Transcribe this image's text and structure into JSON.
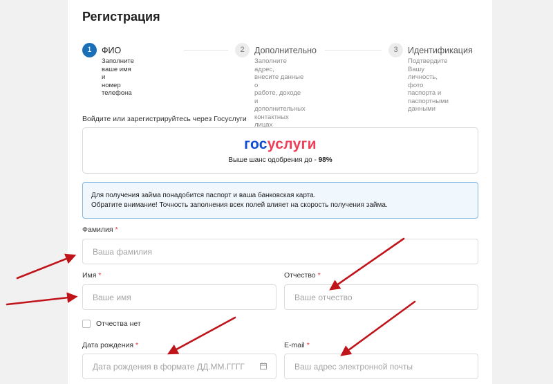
{
  "page": {
    "title": "Регистрация"
  },
  "steps": [
    {
      "number": "1",
      "title": "ФИО",
      "desc_lines": [
        "Заполните ваше имя и",
        "номер телефона"
      ]
    },
    {
      "number": "2",
      "title": "Дополнительно",
      "desc_lines": [
        "Заполните адрес,",
        "внесите данные о",
        "работе, доходе и",
        "дополнительных",
        "контактных лицах"
      ]
    },
    {
      "number": "3",
      "title": "Идентификация",
      "desc_lines": [
        "Подтвердите Вашу",
        "личность, фото",
        "паспорта и",
        "паспортными",
        "данными"
      ]
    }
  ],
  "gosuslugi": {
    "label": "Войдите или зарегистрируйтесь через Госуслуги",
    "logo_part1": "гос",
    "logo_part2": "услуги",
    "subtitle_prefix": "Выше шанс одобрения до - ",
    "subtitle_value": "98%",
    "colors": {
      "blue": "#0d4cd3",
      "red": "#ee3f58"
    }
  },
  "info": {
    "line1": "Для получения займа понадобится паспорт и ваша банковская карта.",
    "line2": "Обратите внимание! Точность заполнения всех полей влияет на скорость получения займа."
  },
  "form": {
    "required_mark": "*",
    "surname": {
      "label": "Фамилия",
      "placeholder": "Ваша фамилия"
    },
    "name": {
      "label": "Имя",
      "placeholder": "Ваше имя"
    },
    "patronymic": {
      "label": "Отчество",
      "placeholder": "Ваше отчество"
    },
    "no_patronymic": {
      "label": "Отчества нет",
      "checked": false
    },
    "birthdate": {
      "label": "Дата рождения",
      "placeholder": "Дата рождения в формате ДД.ММ.ГГГГ",
      "icon": "calendar-icon"
    },
    "email": {
      "label": "E-mail",
      "placeholder": "Ваш адрес электронной почты"
    }
  },
  "annotation": {
    "arrow_color": "#c0141b",
    "icon": "red-arrow"
  },
  "colors": {
    "accent": "#1a6fb6",
    "required": "#e5343d",
    "info_border": "#80b7e0",
    "info_bg": "#f0f7fd"
  }
}
